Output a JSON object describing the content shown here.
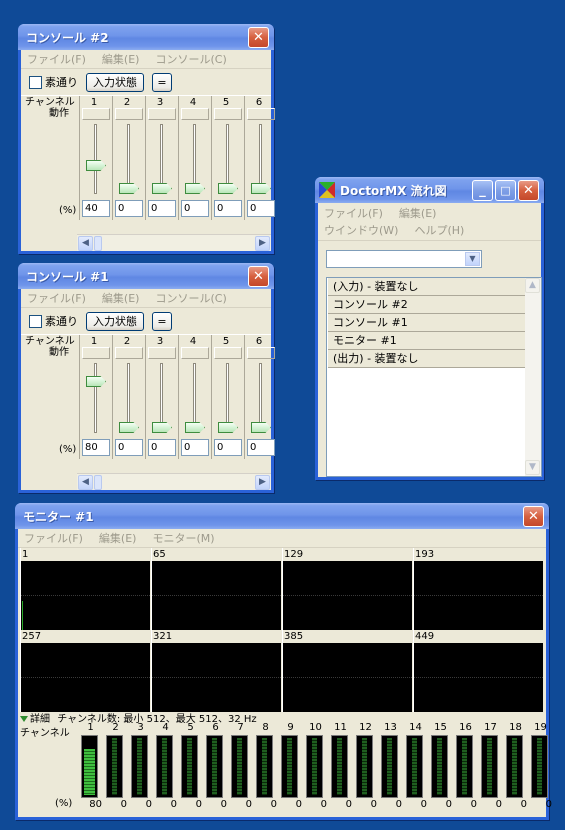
{
  "colors": {
    "desktop": "#0f4a97",
    "window_frame": "#2a62d8",
    "window_body": "#ece9d8",
    "slider_thumb": "#b8e6b8",
    "meter_green": "#3fbf3f",
    "close_button": "#d6603f"
  },
  "console2": {
    "title": "コンソール #2",
    "menu": [
      "ファイル(F)",
      "編集(E)",
      "コンソール(C)"
    ],
    "passthrough_label": "素通り",
    "input_state_label": "入力状態",
    "equals_label": "=",
    "channel_label": "チャンネル",
    "operation_label": "動作",
    "percent_label": "(%)",
    "channels": [
      {
        "num": "1",
        "value": "40",
        "level": 40
      },
      {
        "num": "2",
        "value": "0",
        "level": 0
      },
      {
        "num": "3",
        "value": "0",
        "level": 0
      },
      {
        "num": "4",
        "value": "0",
        "level": 0
      },
      {
        "num": "5",
        "value": "0",
        "level": 0
      },
      {
        "num": "6",
        "value": "0",
        "level": 0
      }
    ]
  },
  "console1": {
    "title": "コンソール #1",
    "menu": [
      "ファイル(F)",
      "編集(E)",
      "コンソール(C)"
    ],
    "passthrough_label": "素通り",
    "input_state_label": "入力状態",
    "equals_label": "=",
    "channel_label": "チャンネル",
    "operation_label": "動作",
    "percent_label": "(%)",
    "channels": [
      {
        "num": "1",
        "value": "80",
        "level": 80
      },
      {
        "num": "2",
        "value": "0",
        "level": 0
      },
      {
        "num": "3",
        "value": "0",
        "level": 0
      },
      {
        "num": "4",
        "value": "0",
        "level": 0
      },
      {
        "num": "5",
        "value": "0",
        "level": 0
      },
      {
        "num": "6",
        "value": "0",
        "level": 0
      }
    ]
  },
  "doctormx": {
    "title": "DoctorMX 流れ図",
    "menu": [
      "ファイル(F)",
      "編集(E)",
      "ウインドウ(W)",
      "ヘルプ(H)"
    ],
    "flow_items": [
      "(入力) - 装置なし",
      "コンソール #2",
      "コンソール #1",
      "モニター #1",
      "(出力) - 装置なし"
    ]
  },
  "monitor": {
    "title": "モニター #1",
    "menu": [
      "ファイル(F)",
      "編集(E)",
      "モニター(M)"
    ],
    "scopes": [
      "1",
      "65",
      "129",
      "193",
      "257",
      "321",
      "385",
      "449"
    ],
    "detail_label": "詳細",
    "channel_info": "チャンネル数: 最小 512、最大 512、32 Hz",
    "channel_label": "チャンネル",
    "percent_label": "(%)",
    "meters": [
      {
        "num": "1",
        "value": "80",
        "level": 80
      },
      {
        "num": "2",
        "value": "0",
        "level": 0
      },
      {
        "num": "3",
        "value": "0",
        "level": 0
      },
      {
        "num": "4",
        "value": "0",
        "level": 0
      },
      {
        "num": "5",
        "value": "0",
        "level": 0
      },
      {
        "num": "6",
        "value": "0",
        "level": 0
      },
      {
        "num": "7",
        "value": "0",
        "level": 0
      },
      {
        "num": "8",
        "value": "0",
        "level": 0
      },
      {
        "num": "9",
        "value": "0",
        "level": 0
      },
      {
        "num": "10",
        "value": "0",
        "level": 0
      },
      {
        "num": "11",
        "value": "0",
        "level": 0
      },
      {
        "num": "12",
        "value": "0",
        "level": 0
      },
      {
        "num": "13",
        "value": "0",
        "level": 0
      },
      {
        "num": "14",
        "value": "0",
        "level": 0
      },
      {
        "num": "15",
        "value": "0",
        "level": 0
      },
      {
        "num": "16",
        "value": "0",
        "level": 0
      },
      {
        "num": "17",
        "value": "0",
        "level": 0
      },
      {
        "num": "18",
        "value": "0",
        "level": 0
      },
      {
        "num": "19",
        "value": "0",
        "level": 0
      }
    ]
  },
  "icons": {
    "close": "close-icon",
    "minimize": "minimize-icon",
    "maximize": "maximize-icon",
    "app": "doctormx-app-icon",
    "scroll_left": "arrow-left-icon",
    "scroll_right": "arrow-right-icon",
    "dropdown": "chevron-down-icon",
    "detail": "triangle-down-icon"
  }
}
